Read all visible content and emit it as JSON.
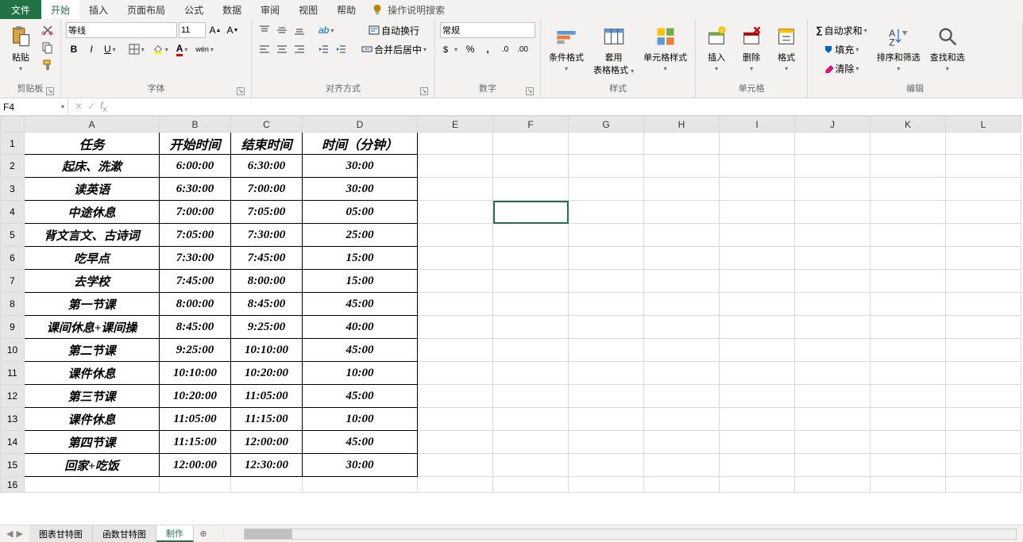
{
  "tabs": {
    "file": "文件",
    "items": [
      "开始",
      "插入",
      "页面布局",
      "公式",
      "数据",
      "审阅",
      "视图",
      "帮助"
    ],
    "active_index": 0,
    "search_hint": "操作说明搜索"
  },
  "ribbon": {
    "clipboard": {
      "paste": "粘贴",
      "label": "剪贴板"
    },
    "font": {
      "name": "等线",
      "size": "11",
      "label": "字体"
    },
    "align": {
      "wrap": "自动换行",
      "merge": "合并后居中",
      "ruby": "wén",
      "label": "对齐方式"
    },
    "number": {
      "format": "常规",
      "label": "数字"
    },
    "styles": {
      "cond": "条件格式",
      "tblfmt": "套用",
      "tblfmt2": "表格格式",
      "cellstyle": "单元格样式",
      "label": "样式"
    },
    "cells": {
      "insert": "插入",
      "delete": "删除",
      "format": "格式",
      "label": "单元格"
    },
    "editing": {
      "sum": "自动求和",
      "fill": "填充",
      "clear": "清除",
      "sort": "排序和筛选",
      "find": "查找和选",
      "label": "编辑"
    }
  },
  "formula_bar": {
    "name_box": "F4",
    "formula": ""
  },
  "columns": [
    "A",
    "B",
    "C",
    "D",
    "E",
    "F",
    "G",
    "H",
    "I",
    "J",
    "K",
    "L"
  ],
  "row_count": 16,
  "selected_cell": {
    "row": 4,
    "col": 5
  },
  "table": {
    "headers": [
      "任务",
      "开始时间",
      "结束时间",
      "时间（分钟）"
    ],
    "rows": [
      [
        "起床、洗漱",
        "6:00:00",
        "6:30:00",
        "30:00"
      ],
      [
        "读英语",
        "6:30:00",
        "7:00:00",
        "30:00"
      ],
      [
        "中途休息",
        "7:00:00",
        "7:05:00",
        "05:00"
      ],
      [
        "背文言文、古诗词",
        "7:05:00",
        "7:30:00",
        "25:00"
      ],
      [
        "吃早点",
        "7:30:00",
        "7:45:00",
        "15:00"
      ],
      [
        "去学校",
        "7:45:00",
        "8:00:00",
        "15:00"
      ],
      [
        "第一节课",
        "8:00:00",
        "8:45:00",
        "45:00"
      ],
      [
        "课间休息+课间操",
        "8:45:00",
        "9:25:00",
        "40:00"
      ],
      [
        "第二节课",
        "9:25:00",
        "10:10:00",
        "45:00"
      ],
      [
        "课件休息",
        "10:10:00",
        "10:20:00",
        "10:00"
      ],
      [
        "第三节课",
        "10:20:00",
        "11:05:00",
        "45:00"
      ],
      [
        "课件休息",
        "11:05:00",
        "11:15:00",
        "10:00"
      ],
      [
        "第四节课",
        "11:15:00",
        "12:00:00",
        "45:00"
      ],
      [
        "回家+吃饭",
        "12:00:00",
        "12:30:00",
        "30:00"
      ]
    ]
  },
  "sheet_tabs": {
    "items": [
      "图表甘特图",
      "函数甘特图",
      "制作"
    ],
    "active_index": 2
  }
}
